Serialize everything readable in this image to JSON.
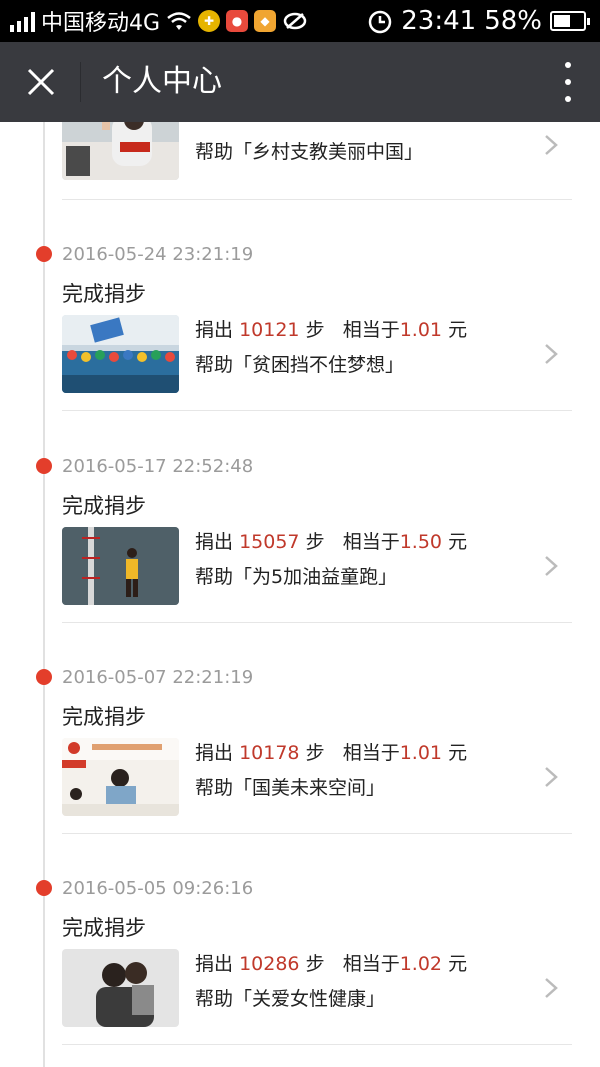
{
  "status_bar": {
    "carrier": "中国移动4G",
    "time": "23:41",
    "battery": "58%",
    "battery_level": 0.58
  },
  "header": {
    "title": "个人中心"
  },
  "first_card": {
    "help_text": "帮助「乡村支教美丽中国」"
  },
  "entries": [
    {
      "timestamp": "2016-05-24 23:21:19",
      "action": "完成捐步",
      "donate_prefix": "捐出",
      "steps": "10121",
      "steps_unit": "步",
      "equiv": "相当于",
      "amount": "1.01",
      "currency": "元",
      "help_text": "帮助「贫困挡不住梦想」"
    },
    {
      "timestamp": "2016-05-17 22:52:48",
      "action": "完成捐步",
      "donate_prefix": "捐出",
      "steps": "15057",
      "steps_unit": "步",
      "equiv": "相当于",
      "amount": "1.50",
      "currency": "元",
      "help_text": "帮助「为5加油益童跑」"
    },
    {
      "timestamp": "2016-05-07 22:21:19",
      "action": "完成捐步",
      "donate_prefix": "捐出",
      "steps": "10178",
      "steps_unit": "步",
      "equiv": "相当于",
      "amount": "1.01",
      "currency": "元",
      "help_text": "帮助「国美未来空间」"
    },
    {
      "timestamp": "2016-05-05 09:26:16",
      "action": "完成捐步",
      "donate_prefix": "捐出",
      "steps": "10286",
      "steps_unit": "步",
      "equiv": "相当于",
      "amount": "1.02",
      "currency": "元",
      "help_text": "帮助「关爱女性健康」"
    }
  ],
  "icons": {
    "close": "close-icon",
    "more": "more-vertical-icon",
    "chevron": "chevron-right-icon"
  },
  "colors": {
    "header_bg": "#393a3f",
    "accent_red": "#e33e2b",
    "amount_red": "#c0392b"
  }
}
